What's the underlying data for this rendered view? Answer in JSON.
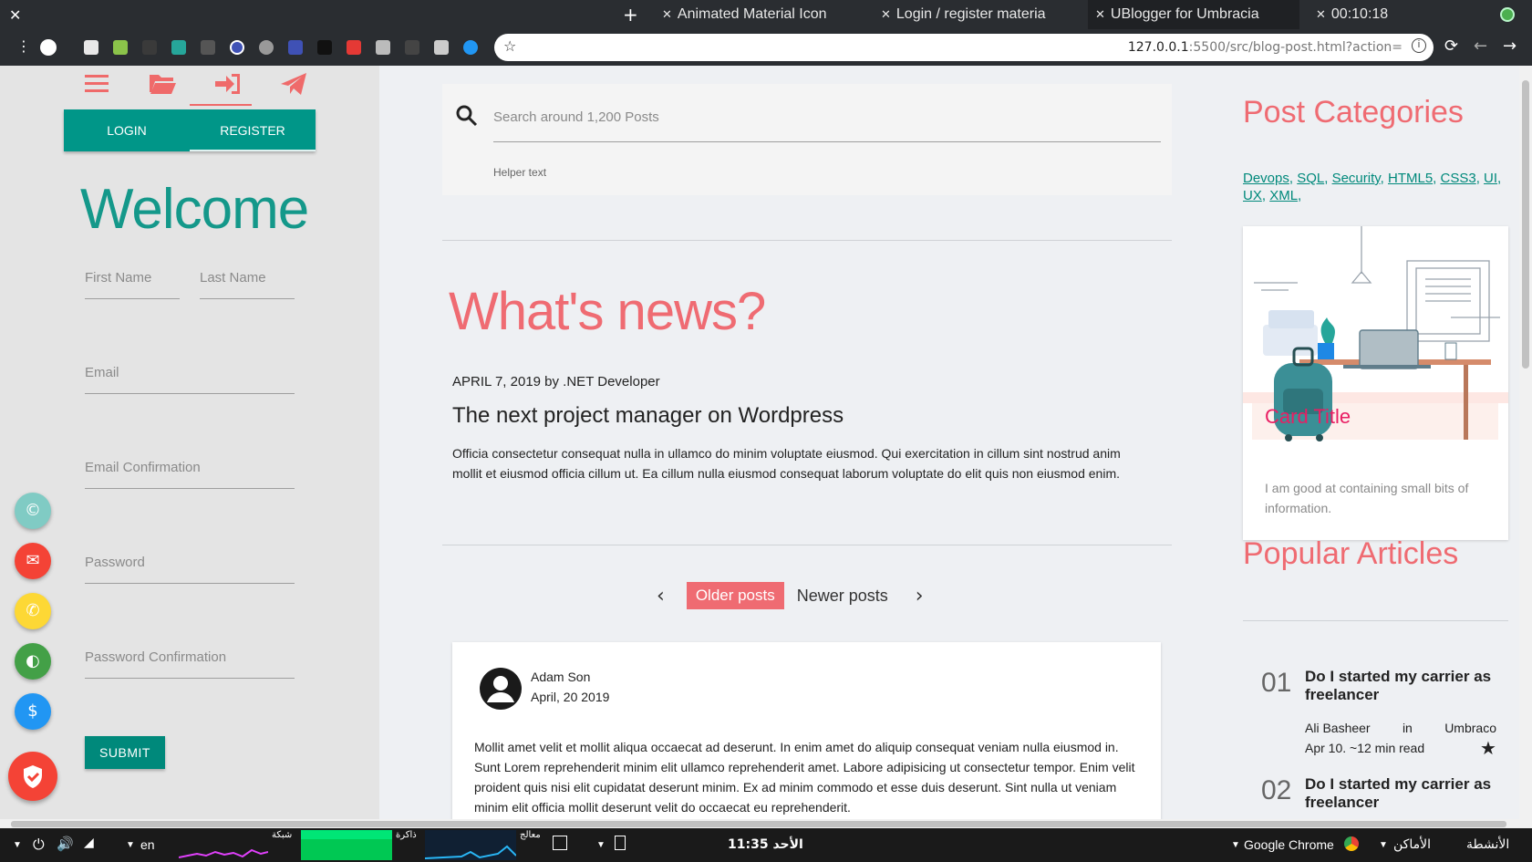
{
  "browser": {
    "tabs": [
      {
        "label": "Animated Material Icon"
      },
      {
        "label": "Login / register materia"
      },
      {
        "label": "UBlogger for Umbracia"
      },
      {
        "label": "00:10:18"
      }
    ],
    "url_host": "127.0.0.1",
    "url_rest": ":5500/src/blog-post.html?action="
  },
  "leftpanel": {
    "tabs": {
      "login": "LOGIN",
      "register": "REGISTER"
    },
    "welcome": "Welcome",
    "fields": {
      "first_name": "First Name",
      "last_name": "Last Name",
      "email": "Email",
      "email_confirm": "Email Confirmation",
      "password": "Password",
      "password_confirm": "Password Confirmation"
    },
    "submit": "SUBMIT"
  },
  "search": {
    "placeholder": "Search around 1,200 Posts",
    "helper": "Helper text"
  },
  "main": {
    "heading": "What's news?",
    "post": {
      "meta": "APRIL 7, 2019 by .NET Developer",
      "title": "The next project manager on Wordpress",
      "excerpt": "Officia consectetur consequat nulla in ullamco do minim voluptate eiusmod. Qui exercitation in cillum sint nostrud anim mollit et eiusmod officia cillum ut. Ea cillum nulla eiusmod consequat laborum voluptate do elit quis non eiusmod enim."
    },
    "pager": {
      "older": "Older posts",
      "newer": "Newer posts"
    },
    "comment": {
      "name": "Adam Son",
      "date": "April, 20 2019",
      "body": "Mollit amet velit et mollit aliqua occaecat ad deserunt. In enim amet do aliquip consequat veniam nulla eiusmod in. Sunt Lorem reprehenderit minim elit ullamco reprehenderit amet. Labore adipisicing ut consectetur tempor. Enim velit proident quis nisi elit cupidatat deserunt minim. Ex ad minim commodo et esse duis deserunt. Sint nulla ut veniam minim elit officia mollit deserunt velit do occaecat eu reprehenderit."
    }
  },
  "sidebar": {
    "categories_title": "Post Categories",
    "categories": [
      "Devops",
      "SQL",
      "Security",
      "HTML5",
      "CSS3",
      "UI",
      "UX",
      "XML"
    ],
    "card": {
      "title": "Card Title",
      "text": "I am good at containing small bits of information."
    },
    "popular_title": "Popular Articles",
    "articles": [
      {
        "num": "01",
        "title": "Do I started my carrier as freelancer",
        "author": "Ali Basheer",
        "in": "in",
        "category": "Umbraco",
        "when": "Apr 10. ~12 min read"
      },
      {
        "num": "02",
        "title": "Do I started my carrier as freelancer"
      }
    ]
  },
  "taskbar": {
    "lang": "en",
    "net": "شبكة",
    "mem": "ذاكرة",
    "cpu": "معالج",
    "clock": "11:35 الأحد",
    "app": "Google Chrome",
    "places": "الأماكن",
    "activities": "الأنشطة"
  },
  "colors": {
    "accent_teal": "#009688",
    "accent_pink": "#ef6b72",
    "card_title": "#e91e63"
  }
}
